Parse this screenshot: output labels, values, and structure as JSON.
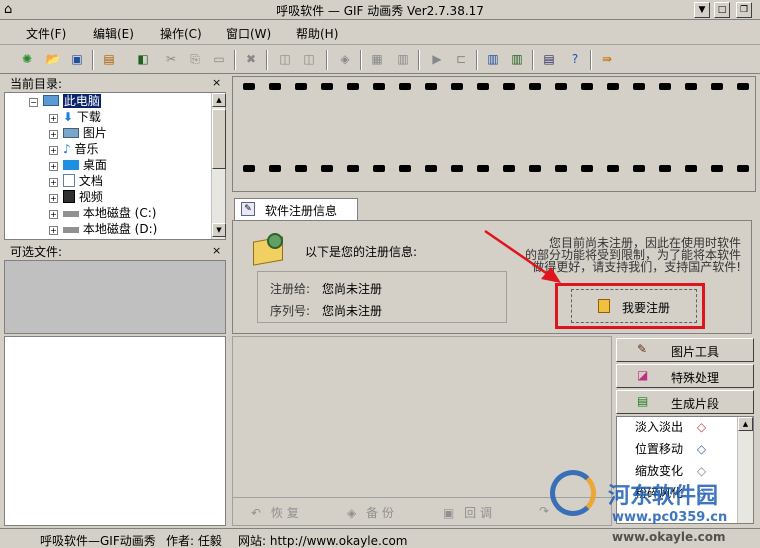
{
  "window": {
    "title": "呼吸软件 — GIF 动画秀 Ver2.7.38.17"
  },
  "menu": [
    "文件(F)",
    "编辑(E)",
    "操作(C)",
    "窗口(W)",
    "帮助(H)"
  ],
  "current_dir": {
    "label": "当前目录:",
    "close": "×",
    "items": [
      {
        "label": "此电脑",
        "icon": "computer-icon"
      },
      {
        "label": "下载",
        "icon": "download-icon"
      },
      {
        "label": "图片",
        "icon": "pictures-icon"
      },
      {
        "label": "音乐",
        "icon": "music-icon"
      },
      {
        "label": "桌面",
        "icon": "desktop-icon"
      },
      {
        "label": "文档",
        "icon": "document-icon"
      },
      {
        "label": "视频",
        "icon": "video-icon"
      },
      {
        "label": "本地磁盘 (C:)",
        "icon": "disk-icon"
      },
      {
        "label": "本地磁盘 (D:)",
        "icon": "disk-icon"
      }
    ]
  },
  "optional_files": {
    "label": "可选文件:",
    "close": "×"
  },
  "reg_tab": {
    "label": "软件注册信息"
  },
  "registration": {
    "heading": "以下是您的注册信息:",
    "reg_to_label": "注册给:",
    "reg_to_value": "您尚未注册",
    "serial_label": "序列号:",
    "serial_value": "您尚未注册",
    "notice_line1": "您目前尚未注册，因此在使用时软件",
    "notice_line2": "的部分功能将受到限制，为了能将本软件",
    "notice_line3": "做得更好，请支持我们，支持国产软件!",
    "register_button": "我要注册",
    "highlight_color": "#e0141c",
    "arrow_color": "#e0141c"
  },
  "tools": {
    "image_tools": "图片工具",
    "special_process": "特殊处理",
    "make_clip": "生成片段",
    "effects": [
      "淡入淡出",
      "位置移动",
      "缩放变化",
      "粉碎风化"
    ]
  },
  "bottom_actions": [
    "恢 复",
    "备 份",
    "回 调"
  ],
  "status": {
    "product": "呼吸软件—GIF动画秀",
    "author": "作者: 任毅",
    "website": "网站: http://www.okayle.com"
  },
  "watermark": {
    "line1": "河东软件园",
    "line2": "www.pc0359.cn",
    "line3": "www.okayle.com"
  }
}
